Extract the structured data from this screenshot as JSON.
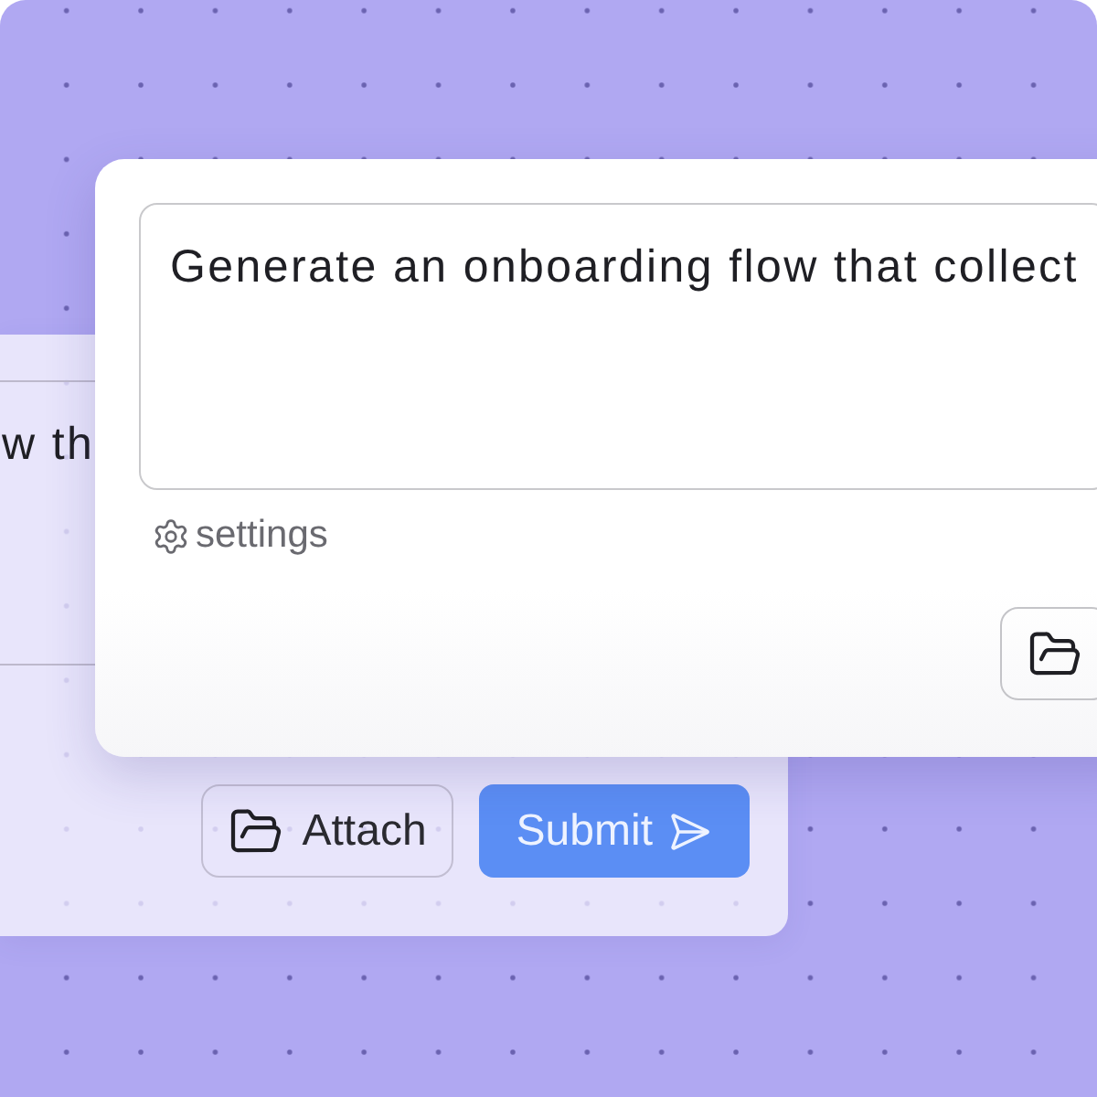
{
  "back_window": {
    "prompt_field": {
      "value": "w th"
    },
    "buttons": [
      {
        "kind": "attach",
        "label": "Attach"
      },
      {
        "kind": "submit",
        "label": "Submit"
      }
    ]
  },
  "front_window": {
    "prompt_field": {
      "value": "Generate an onboarding flow that collect"
    },
    "settings_link": {
      "label": "settings"
    },
    "buttons": [
      {
        "kind": "attach"
      }
    ]
  }
}
